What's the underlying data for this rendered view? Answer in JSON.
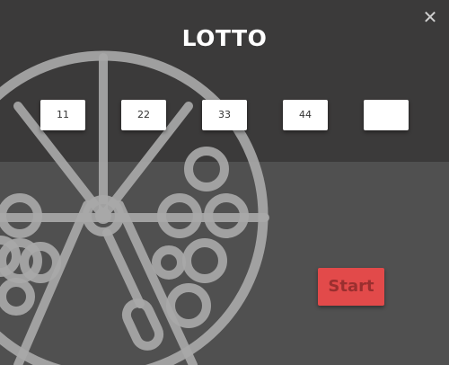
{
  "dialog": {
    "title": "LOTTO",
    "close_symbol": "✕",
    "numbers": [
      {
        "value": "11"
      },
      {
        "value": "22"
      },
      {
        "value": "33"
      },
      {
        "value": "44"
      },
      {
        "value": ""
      }
    ],
    "start_label": "Start"
  },
  "icons": {
    "background_art": "lottery-wheel-icon",
    "close": "close-icon"
  },
  "colors": {
    "top_band": "#3b3a3a",
    "bottom_band": "#505050",
    "wheel_art": "#a8a8a8",
    "start_button": "#e24a4a",
    "start_text": "#9a2f2f"
  }
}
